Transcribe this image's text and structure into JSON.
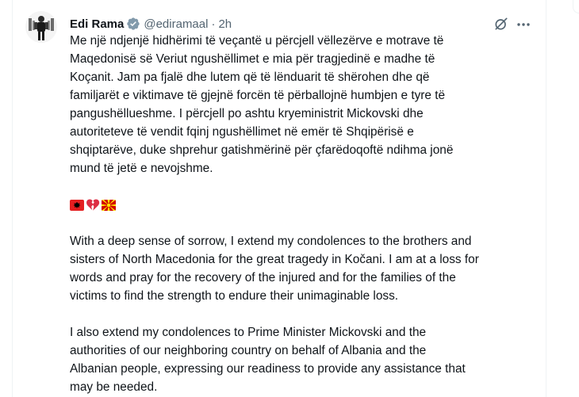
{
  "tweet": {
    "author_name": "Edi Rama",
    "handle": "@ediramaal",
    "separator": "·",
    "time": "2h",
    "paragraph_sq": [
      "Me një ndjenjë hidhërimi të veçantë u përcjell vëllezërve e motrave të",
      "Maqedonisë së Veriut ngushëllimet e mia për tragjedinë e madhe të",
      "Koçanit. Jam pa fjalë dhe lutem që të lënduarit të shërohen dhe që",
      "familjarët e viktimave të gjejnë forcën të përballojnë humbjen e tyre të",
      "pangushëllueshme. I përcjell po ashtu kryeministrit Mickovski dhe",
      "autoriteteve të vendit fqinj ngushëllimet në emër të Shqipërisë e",
      "shqiptarëve, duke shprehur gatishmërinë për çfarëdoqoftë ndihma jonë",
      "mund të jetë e nevojshme."
    ],
    "emojis": [
      "albania-flag",
      "broken-heart",
      "north-macedonia-flag"
    ],
    "paragraph_en_1": [
      "With a deep sense of sorrow, I extend my condolences to the brothers and",
      "sisters of North Macedonia for the great tragedy in Kočani. I am at a loss for",
      "words and pray for the recovery of the injured and for the families of the",
      "victims to find the strength to endure their unimaginable loss."
    ],
    "paragraph_en_2": [
      "I also extend my condolences to Prime Minister Mickovski and the",
      "authorities of our neighboring country on behalf of Albania and the",
      "Albanian people, expressing our readiness to provide any assistance that",
      "may be needed."
    ]
  },
  "colors": {
    "text": "#0f1419",
    "secondary": "#536471",
    "verified": "#829aab",
    "albania_red": "#e41e20",
    "macedonia_red": "#d20000",
    "macedonia_yellow": "#ffe600",
    "heart_red": "#dd2e44"
  },
  "icons": {
    "verified": "verified-badge-icon",
    "grok": "grok-icon",
    "more": "more-options-icon"
  }
}
